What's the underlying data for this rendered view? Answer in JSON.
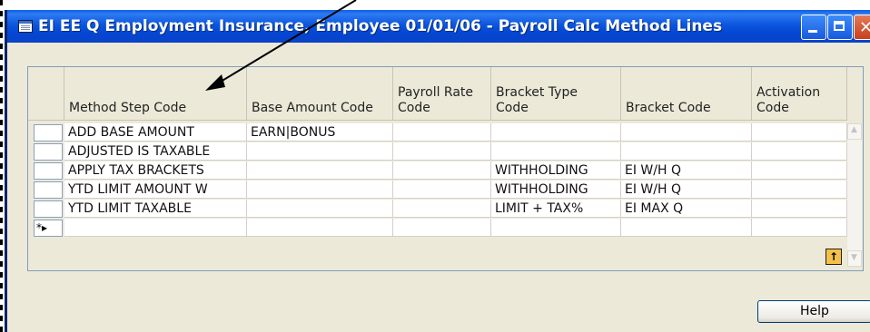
{
  "window": {
    "title": "EI EE Q Employment Insurance, Employee 01/01/06 - Payroll Calc Method Lines"
  },
  "table": {
    "columns": [
      {
        "key": "method_step_code",
        "label": "Method Step Code"
      },
      {
        "key": "base_amount_code",
        "label": "Base Amount Code"
      },
      {
        "key": "payroll_rate_code",
        "label": "Payroll Rate Code"
      },
      {
        "key": "bracket_type_code",
        "label": "Bracket Type Code"
      },
      {
        "key": "bracket_code",
        "label": "Bracket Code"
      },
      {
        "key": "activation_code",
        "label": "Activation Code"
      }
    ],
    "rows": [
      {
        "method_step_code": "ADD BASE AMOUNT",
        "base_amount_code": "EARN|BONUS",
        "payroll_rate_code": "",
        "bracket_type_code": "",
        "bracket_code": "",
        "activation_code": ""
      },
      {
        "method_step_code": "ADJUSTED IS TAXABLE",
        "base_amount_code": "",
        "payroll_rate_code": "",
        "bracket_type_code": "",
        "bracket_code": "",
        "activation_code": ""
      },
      {
        "method_step_code": "APPLY TAX BRACKETS",
        "base_amount_code": "",
        "payroll_rate_code": "",
        "bracket_type_code": "WITHHOLDING",
        "bracket_code": "EI W/H Q",
        "activation_code": ""
      },
      {
        "method_step_code": "YTD LIMIT AMOUNT W",
        "base_amount_code": "",
        "payroll_rate_code": "",
        "bracket_type_code": "WITHHOLDING",
        "bracket_code": "EI W/H Q",
        "activation_code": ""
      },
      {
        "method_step_code": "YTD LIMIT TAXABLE",
        "base_amount_code": "",
        "payroll_rate_code": "",
        "bracket_type_code": "LIMIT + TAX%",
        "bracket_code": "EI MAX Q",
        "activation_code": ""
      }
    ],
    "new_row_marker": "*▸"
  },
  "buttons": {
    "help": "Help",
    "goto": "↑"
  },
  "icons": {
    "app": "table-window-icon",
    "minimize": "minimize-icon",
    "maximize": "maximize-icon",
    "close": "close-icon"
  },
  "colors": {
    "titlebar": "#0446D2",
    "window_bg": "#ECE9D8",
    "close_button": "#C7401D"
  }
}
